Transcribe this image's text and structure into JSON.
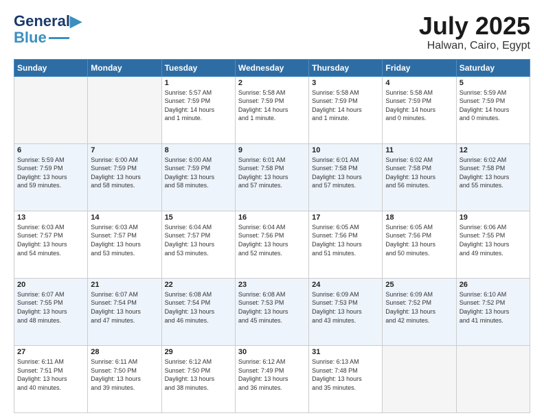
{
  "logo": {
    "line1": "General",
    "line2": "Blue"
  },
  "title": "July 2025",
  "subtitle": "Halwan, Cairo, Egypt",
  "days_of_week": [
    "Sunday",
    "Monday",
    "Tuesday",
    "Wednesday",
    "Thursday",
    "Friday",
    "Saturday"
  ],
  "weeks": [
    [
      {
        "day": "",
        "info": ""
      },
      {
        "day": "",
        "info": ""
      },
      {
        "day": "1",
        "info": "Sunrise: 5:57 AM\nSunset: 7:59 PM\nDaylight: 14 hours\nand 1 minute."
      },
      {
        "day": "2",
        "info": "Sunrise: 5:58 AM\nSunset: 7:59 PM\nDaylight: 14 hours\nand 1 minute."
      },
      {
        "day": "3",
        "info": "Sunrise: 5:58 AM\nSunset: 7:59 PM\nDaylight: 14 hours\nand 1 minute."
      },
      {
        "day": "4",
        "info": "Sunrise: 5:58 AM\nSunset: 7:59 PM\nDaylight: 14 hours\nand 0 minutes."
      },
      {
        "day": "5",
        "info": "Sunrise: 5:59 AM\nSunset: 7:59 PM\nDaylight: 14 hours\nand 0 minutes."
      }
    ],
    [
      {
        "day": "6",
        "info": "Sunrise: 5:59 AM\nSunset: 7:59 PM\nDaylight: 13 hours\nand 59 minutes."
      },
      {
        "day": "7",
        "info": "Sunrise: 6:00 AM\nSunset: 7:59 PM\nDaylight: 13 hours\nand 58 minutes."
      },
      {
        "day": "8",
        "info": "Sunrise: 6:00 AM\nSunset: 7:59 PM\nDaylight: 13 hours\nand 58 minutes."
      },
      {
        "day": "9",
        "info": "Sunrise: 6:01 AM\nSunset: 7:58 PM\nDaylight: 13 hours\nand 57 minutes."
      },
      {
        "day": "10",
        "info": "Sunrise: 6:01 AM\nSunset: 7:58 PM\nDaylight: 13 hours\nand 57 minutes."
      },
      {
        "day": "11",
        "info": "Sunrise: 6:02 AM\nSunset: 7:58 PM\nDaylight: 13 hours\nand 56 minutes."
      },
      {
        "day": "12",
        "info": "Sunrise: 6:02 AM\nSunset: 7:58 PM\nDaylight: 13 hours\nand 55 minutes."
      }
    ],
    [
      {
        "day": "13",
        "info": "Sunrise: 6:03 AM\nSunset: 7:57 PM\nDaylight: 13 hours\nand 54 minutes."
      },
      {
        "day": "14",
        "info": "Sunrise: 6:03 AM\nSunset: 7:57 PM\nDaylight: 13 hours\nand 53 minutes."
      },
      {
        "day": "15",
        "info": "Sunrise: 6:04 AM\nSunset: 7:57 PM\nDaylight: 13 hours\nand 53 minutes."
      },
      {
        "day": "16",
        "info": "Sunrise: 6:04 AM\nSunset: 7:56 PM\nDaylight: 13 hours\nand 52 minutes."
      },
      {
        "day": "17",
        "info": "Sunrise: 6:05 AM\nSunset: 7:56 PM\nDaylight: 13 hours\nand 51 minutes."
      },
      {
        "day": "18",
        "info": "Sunrise: 6:05 AM\nSunset: 7:56 PM\nDaylight: 13 hours\nand 50 minutes."
      },
      {
        "day": "19",
        "info": "Sunrise: 6:06 AM\nSunset: 7:55 PM\nDaylight: 13 hours\nand 49 minutes."
      }
    ],
    [
      {
        "day": "20",
        "info": "Sunrise: 6:07 AM\nSunset: 7:55 PM\nDaylight: 13 hours\nand 48 minutes."
      },
      {
        "day": "21",
        "info": "Sunrise: 6:07 AM\nSunset: 7:54 PM\nDaylight: 13 hours\nand 47 minutes."
      },
      {
        "day": "22",
        "info": "Sunrise: 6:08 AM\nSunset: 7:54 PM\nDaylight: 13 hours\nand 46 minutes."
      },
      {
        "day": "23",
        "info": "Sunrise: 6:08 AM\nSunset: 7:53 PM\nDaylight: 13 hours\nand 45 minutes."
      },
      {
        "day": "24",
        "info": "Sunrise: 6:09 AM\nSunset: 7:53 PM\nDaylight: 13 hours\nand 43 minutes."
      },
      {
        "day": "25",
        "info": "Sunrise: 6:09 AM\nSunset: 7:52 PM\nDaylight: 13 hours\nand 42 minutes."
      },
      {
        "day": "26",
        "info": "Sunrise: 6:10 AM\nSunset: 7:52 PM\nDaylight: 13 hours\nand 41 minutes."
      }
    ],
    [
      {
        "day": "27",
        "info": "Sunrise: 6:11 AM\nSunset: 7:51 PM\nDaylight: 13 hours\nand 40 minutes."
      },
      {
        "day": "28",
        "info": "Sunrise: 6:11 AM\nSunset: 7:50 PM\nDaylight: 13 hours\nand 39 minutes."
      },
      {
        "day": "29",
        "info": "Sunrise: 6:12 AM\nSunset: 7:50 PM\nDaylight: 13 hours\nand 38 minutes."
      },
      {
        "day": "30",
        "info": "Sunrise: 6:12 AM\nSunset: 7:49 PM\nDaylight: 13 hours\nand 36 minutes."
      },
      {
        "day": "31",
        "info": "Sunrise: 6:13 AM\nSunset: 7:48 PM\nDaylight: 13 hours\nand 35 minutes."
      },
      {
        "day": "",
        "info": ""
      },
      {
        "day": "",
        "info": ""
      }
    ]
  ]
}
